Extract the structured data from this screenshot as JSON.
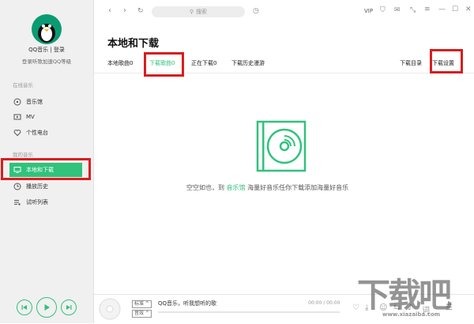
{
  "user": {
    "login": "QQ音乐 | 登录",
    "hint": "登录听歌加速QQ等级"
  },
  "sections": {
    "online": "在线音乐",
    "mine": "我的音乐"
  },
  "nav": {
    "online": [
      {
        "label": "音乐馆"
      },
      {
        "label": "MV"
      },
      {
        "label": "个性电台"
      }
    ],
    "mine": [
      {
        "label": "本地和下载"
      },
      {
        "label": "播放历史"
      },
      {
        "label": "试听列表"
      }
    ]
  },
  "toolbar": {
    "search_placeholder": "搜索",
    "vip": "VIP"
  },
  "page": {
    "title": "本地和下载",
    "tabs": [
      "本地歌曲0",
      "下载歌曲0",
      "正在下载0",
      "下载历史漫游"
    ],
    "right_links": [
      "下载目录",
      "下载设置"
    ]
  },
  "empty": {
    "prefix": "空空如也，到 ",
    "link": "音乐馆",
    "suffix": " 海量好音乐任你下载添加海量好音乐"
  },
  "player": {
    "quality": "标准",
    "sound": "音效",
    "song": "QQ音乐，听我想听的歌",
    "time": "00:00 / 00:00"
  },
  "watermark": {
    "text": "下载吧",
    "url": "www.xiazaiba.com"
  },
  "colors": {
    "accent": "#31c27c",
    "highlight": "#d71e1e"
  }
}
